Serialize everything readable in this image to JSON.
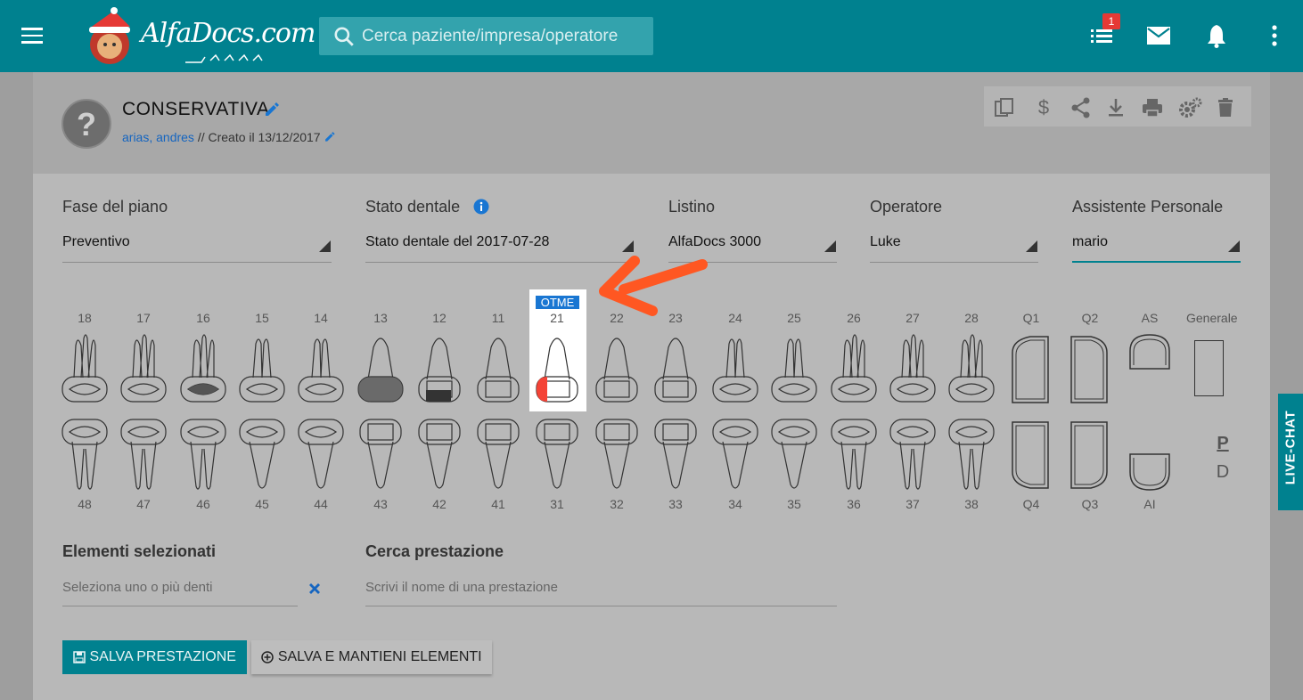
{
  "header": {
    "logo_text": "AlfaDocs.com",
    "search_placeholder": "Cerca paziente/impresa/operatore",
    "notifications_badge": "1"
  },
  "plan": {
    "title": "CONSERVATIVA",
    "author": "arias, andres",
    "created": " // Creato il 13/12/2017"
  },
  "fields": {
    "fase_label": "Fase del piano",
    "fase_value": "Preventivo",
    "stato_label": "Stato dentale",
    "stato_value": "Stato dentale del 2017-07-28",
    "listino_label": "Listino",
    "listino_value": "AlfaDocs 3000",
    "operatore_label": "Operatore",
    "operatore_value": "Luke",
    "assistente_label": "Assistente Personale",
    "assistente_value": "mario"
  },
  "chart": {
    "upper": [
      "18",
      "17",
      "16",
      "15",
      "14",
      "13",
      "12",
      "11",
      "21",
      "22",
      "23",
      "24",
      "25",
      "26",
      "27",
      "28"
    ],
    "lower": [
      "48",
      "47",
      "46",
      "45",
      "44",
      "43",
      "42",
      "41",
      "31",
      "32",
      "33",
      "34",
      "35",
      "36",
      "37",
      "38"
    ],
    "quadrants_upper": [
      "Q1",
      "Q2",
      "AS",
      "Generale"
    ],
    "quadrants_lower": [
      "Q4",
      "Q3",
      "AI"
    ],
    "highlight_tooth": "21",
    "highlight_tag": "OTME",
    "p_label": "P",
    "d_label": "D"
  },
  "selection": {
    "elements_label": "Elementi selezionati",
    "elements_placeholder": "Seleziona uno o più denti",
    "search_label": "Cerca prestazione",
    "search_placeholder": "Scrivi il nome di una prestazione"
  },
  "buttons": {
    "save": "SALVA PRESTAZIONE",
    "save_keep": "SALVA E MANTIENI ELEMENTI"
  },
  "livechat": "LIVE-CHAT",
  "colors": {
    "brand": "#00818f",
    "badge": "#e53935",
    "tag": "#1976d2",
    "arrow": "#ff5722"
  }
}
